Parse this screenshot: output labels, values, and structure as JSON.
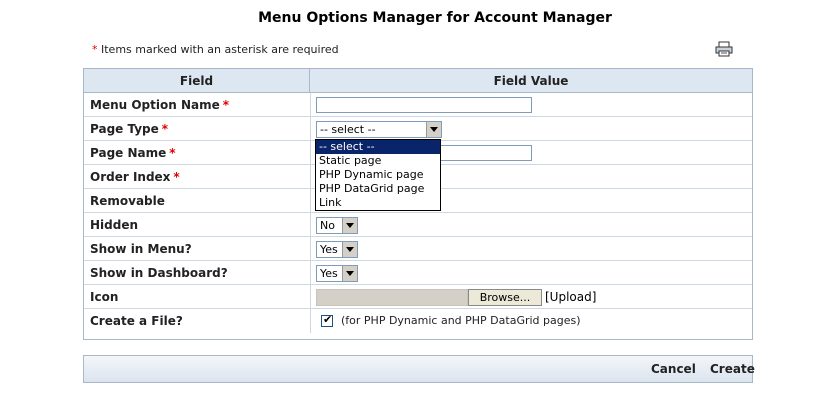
{
  "page": {
    "title": "Menu Options Manager for Account Manager",
    "required_star": "*",
    "required_note": "Items marked with an asterisk are required",
    "print_icon": "printer-icon"
  },
  "table": {
    "headers": {
      "field": "Field",
      "value": "Field Value"
    },
    "rows": {
      "menu_option_name": {
        "label": "Menu Option Name",
        "required": "*",
        "value": ""
      },
      "page_type": {
        "label": "Page Type",
        "required": "*",
        "selected": "-- select --"
      },
      "page_name": {
        "label": "Page Name",
        "required": "*",
        "value": ""
      },
      "order_index": {
        "label": "Order Index",
        "required": "*"
      },
      "removable": {
        "label": "Removable"
      },
      "hidden": {
        "label": "Hidden",
        "selected": "No"
      },
      "show_in_menu": {
        "label": "Show in Menu?",
        "selected": "Yes"
      },
      "show_in_dashboard": {
        "label": "Show in Dashboard?",
        "selected": "Yes"
      },
      "icon": {
        "label": "Icon",
        "browse_label": "Browse...",
        "upload_label": "[Upload]"
      },
      "create_file": {
        "label": "Create a File?",
        "checked": true,
        "note": "(for PHP Dynamic and PHP DataGrid pages)"
      }
    }
  },
  "page_type_dropdown": {
    "options": [
      "-- select --",
      "Static page",
      "PHP Dynamic page",
      "PHP DataGrid page",
      "Link"
    ],
    "highlighted": "-- select --"
  },
  "footer": {
    "cancel_label": "Cancel",
    "create_label": "Create"
  },
  "colors": {
    "header_bg": "#dde7f1",
    "border": "#a9b8c8",
    "required": "#e00000",
    "highlight": "#0a246a"
  }
}
